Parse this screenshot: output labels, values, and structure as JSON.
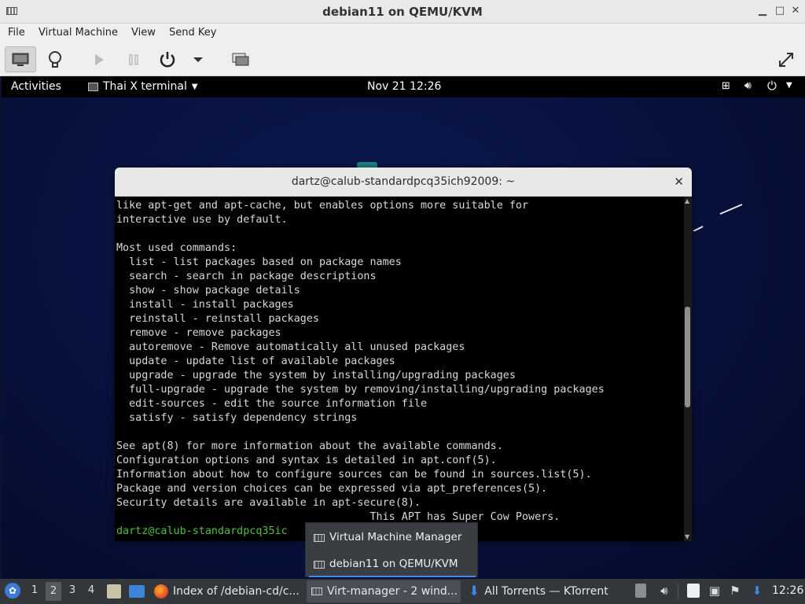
{
  "host_window": {
    "title": "debian11 on QEMU/KVM",
    "minimize": "▁",
    "maximize": "□",
    "close": "✕"
  },
  "menu": {
    "items": [
      "File",
      "Virtual Machine",
      "View",
      "Send Key"
    ]
  },
  "toolbar": {
    "buttons": [
      "console-icon",
      "details-lightbulb-icon",
      "play-icon",
      "pause-icon",
      "power-icon",
      "dropdown-arrow-icon",
      "snapshots-icon",
      "fullscreen-icon"
    ]
  },
  "gnome_bar": {
    "activities": "Activities",
    "app_menu": "Thai X terminal",
    "clock": "Nov 21  12:26"
  },
  "terminal": {
    "title": "dartz@calub-standardpcq35ich92009: ~",
    "lines": [
      "like apt-get and apt-cache, but enables options more suitable for",
      "interactive use by default.",
      "",
      "Most used commands:",
      "  list - list packages based on package names",
      "  search - search in package descriptions",
      "  show - show package details",
      "  install - install packages",
      "  reinstall - reinstall packages",
      "  remove - remove packages",
      "  autoremove - Remove automatically all unused packages",
      "  update - update list of available packages",
      "  upgrade - upgrade the system by installing/upgrading packages",
      "  full-upgrade - upgrade the system by removing/installing/upgrading packages",
      "  edit-sources - edit the source information file",
      "  satisfy - satisfy dependency strings",
      "",
      "See apt(8) for more information about the available commands.",
      "Configuration options and syntax is detailed in apt.conf(5).",
      "Information about how to configure sources can be found in sources.list(5).",
      "Package and version choices can be expressed via apt_preferences(5).",
      "Security details are available in apt-secure(8).",
      "                                        This APT has Super Cow Powers."
    ],
    "prompt": "dartz@calub-standardpcq35ic"
  },
  "popup": {
    "items": [
      "Virtual Machine Manager",
      "debian11 on QEMU/KVM"
    ]
  },
  "taskbar": {
    "workspaces": [
      "1",
      "2",
      "3",
      "4"
    ],
    "active_workspace": "2",
    "tasks": [
      "Index of /debian-cd/c...",
      "Virt-manager - 2 wind...",
      "All Torrents — KTorrent"
    ],
    "clock": "12:26"
  }
}
